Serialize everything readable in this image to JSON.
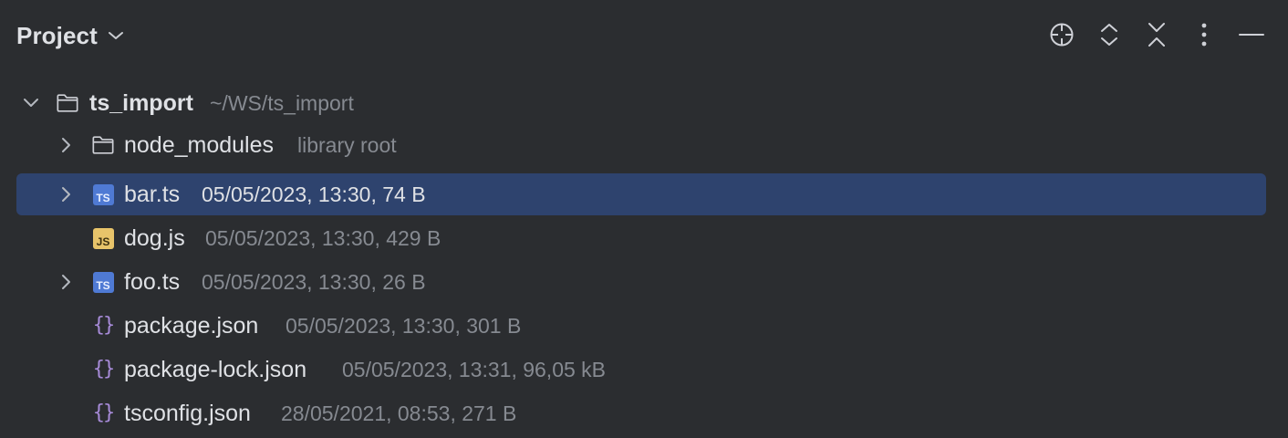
{
  "header": {
    "title": "Project",
    "toolbar": [
      {
        "icon": "locate-icon"
      },
      {
        "icon": "expand-all-icon"
      },
      {
        "icon": "collapse-all-icon"
      },
      {
        "icon": "more-options-icon"
      },
      {
        "icon": "minimize-icon"
      }
    ]
  },
  "tree": {
    "root": {
      "name": "ts_import",
      "path": "~/WS/ts_import",
      "expanded": true
    },
    "items": [
      {
        "name": "node_modules",
        "meta": "library root",
        "type": "folder",
        "expandable": true
      },
      {
        "name": "bar.ts",
        "meta": "05/05/2023, 13:30, 74 B",
        "type": "ts",
        "badge": "TS",
        "expandable": true,
        "selected": true
      },
      {
        "name": "dog.js",
        "meta": "05/05/2023, 13:30, 429 B",
        "type": "js",
        "badge": "JS",
        "expandable": false
      },
      {
        "name": "foo.ts",
        "meta": "05/05/2023, 13:30, 26 B",
        "type": "ts",
        "badge": "TS",
        "expandable": true
      },
      {
        "name": "package.json",
        "meta": "05/05/2023, 13:30, 301 B",
        "type": "json",
        "badge": "{}",
        "expandable": false
      },
      {
        "name": "package-lock.json",
        "meta": "05/05/2023, 13:31, 96,05 kB",
        "type": "json",
        "badge": "{}",
        "expandable": false
      },
      {
        "name": "tsconfig.json",
        "meta": "28/05/2021, 08:53, 271 B",
        "type": "json",
        "badge": "{}",
        "expandable": false
      }
    ]
  },
  "colors": {
    "background": "#2b2d30",
    "selection": "#2e436e",
    "text": "#dfe1e5",
    "muted": "#868a91",
    "ts_badge": "#4f7ad4",
    "js_badge": "#e8c46a",
    "json_brace": "#a78bd8"
  }
}
